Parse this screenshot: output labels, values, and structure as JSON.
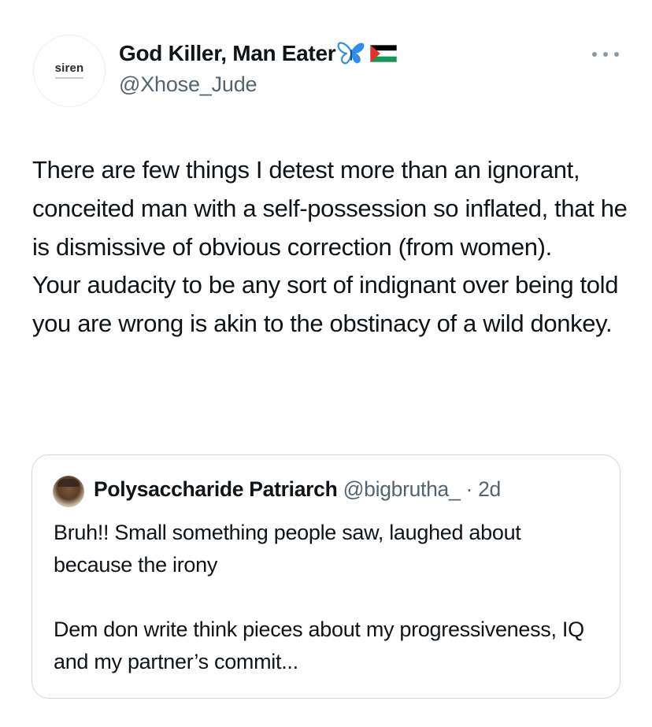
{
  "author": {
    "avatar_text": "siren",
    "display_name": "God Killer, Man Eater",
    "emoji": [
      "butterfly",
      "palestine-flag"
    ],
    "handle": "@Xhose_Jude"
  },
  "tweet": {
    "paragraphs": [
      "There are few things I detest more than an ignorant, conceited man with a self-possession so inflated, that he is dismissive of obvious correction (from women).",
      "Your audacity to be any sort of indignant over being told you are wrong is akin to the obstinacy of a wild donkey."
    ]
  },
  "quoted": {
    "display_name": "Polysaccharide Patriarch",
    "handle": "@bigbrutha_",
    "time": "· 2d",
    "paragraphs": [
      "Bruh!! Small something people saw, laughed about because the irony",
      "Dem don write think pieces about my progressiveness, IQ and my partner’s commit..."
    ]
  },
  "icons": {
    "more": "more-horizontal-icon"
  },
  "colors": {
    "text": "#0f1419",
    "secondary": "#536471",
    "border": "#cfd9de",
    "butterfly": "#2f8ee8"
  }
}
